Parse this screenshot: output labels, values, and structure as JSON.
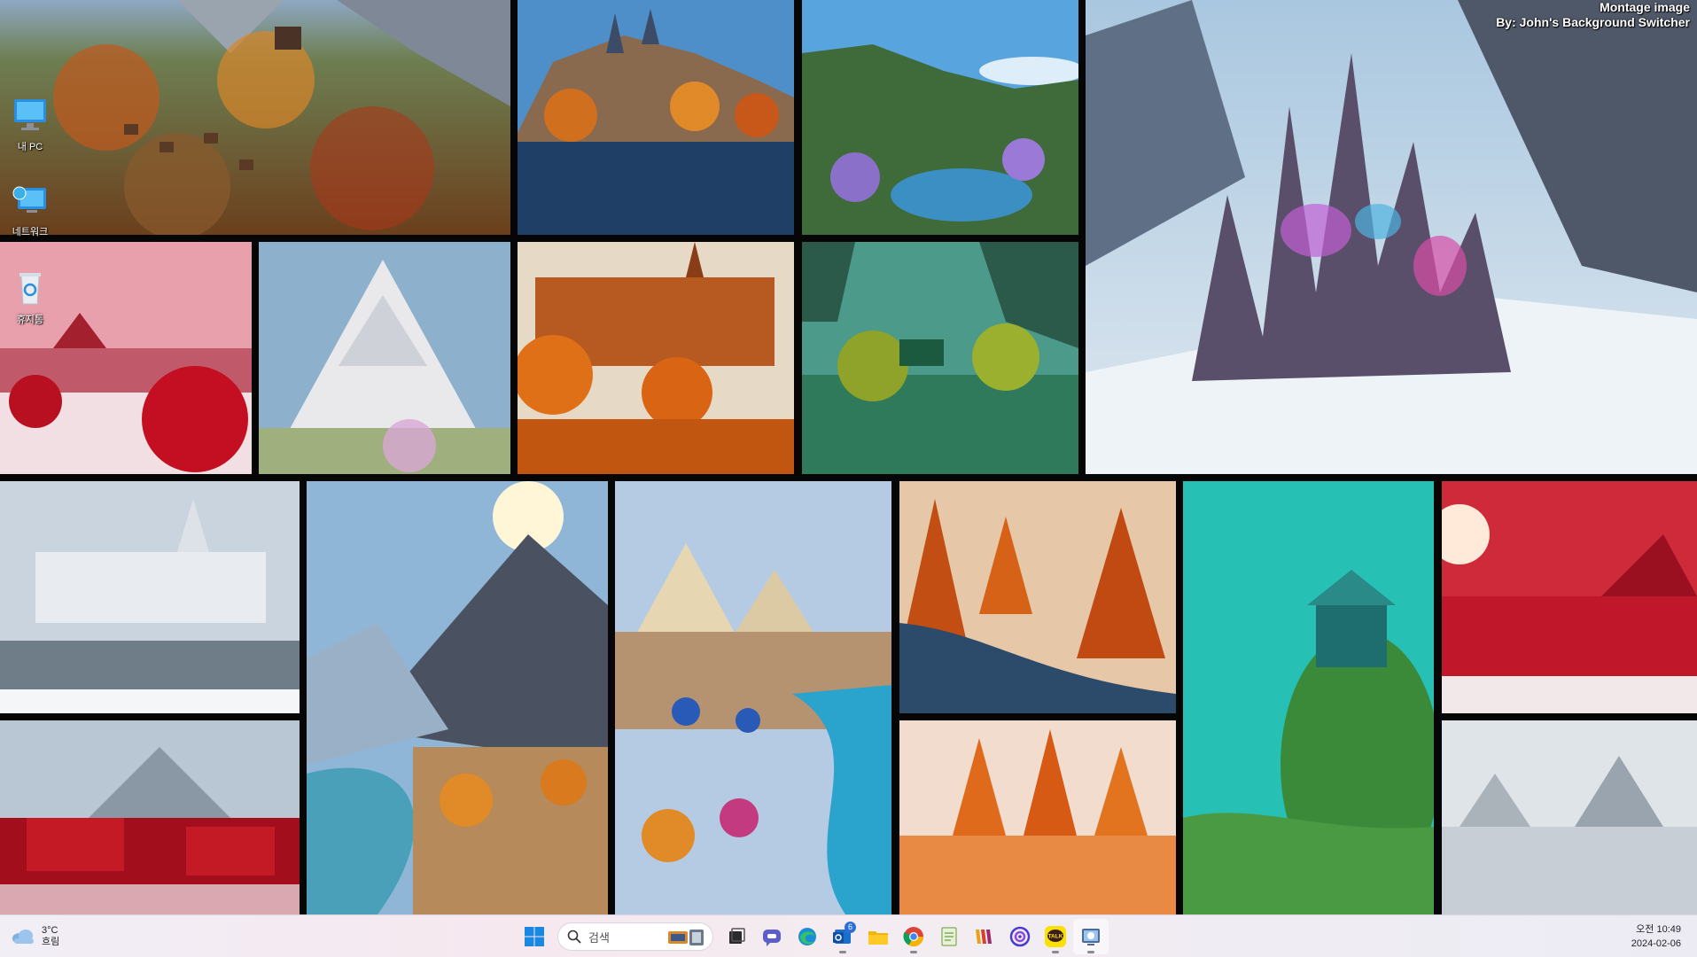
{
  "wallpaper": {
    "caption_line1": "Montage image",
    "caption_line2": "By: John's Background Switcher"
  },
  "desktop_icons": [
    {
      "label": "내 PC",
      "icon": "monitor-icon"
    },
    {
      "label": "네트워크",
      "icon": "network-icon"
    },
    {
      "label": "휴지통",
      "icon": "recycle-bin-icon"
    }
  ],
  "taskbar": {
    "weather_temp": "3°C",
    "weather_desc": "흐림",
    "search_placeholder": "검색",
    "apps": [
      {
        "name": "start-button",
        "icon": "windows-logo-icon"
      },
      {
        "name": "task-view",
        "icon": "task-view-icon"
      },
      {
        "name": "chat-app",
        "icon": "chat-icon"
      },
      {
        "name": "edge-browser",
        "icon": "edge-icon"
      },
      {
        "name": "outlook",
        "icon": "outlook-icon",
        "badge": "6"
      },
      {
        "name": "file-explorer",
        "icon": "folder-icon"
      },
      {
        "name": "chrome",
        "icon": "chrome-icon"
      },
      {
        "name": "notepad",
        "icon": "notepad-icon"
      },
      {
        "name": "winamp",
        "icon": "winamp-icon"
      },
      {
        "name": "nord",
        "icon": "spiral-icon"
      },
      {
        "name": "kakaotalk",
        "icon": "talk-icon",
        "label": "TALK"
      },
      {
        "name": "background-switcher",
        "icon": "background-switcher-icon"
      }
    ],
    "time": "오전 10:49",
    "date": "2024-02-06"
  }
}
